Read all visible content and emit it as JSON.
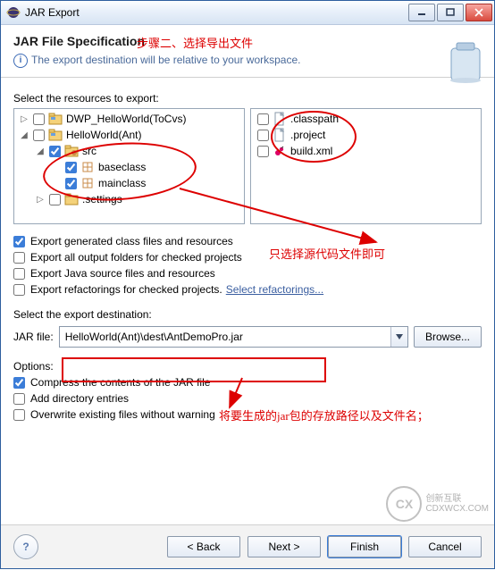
{
  "window": {
    "title": "JAR Export"
  },
  "header": {
    "title": "JAR File Specification",
    "subtitle": "The export destination will be relative to your workspace.",
    "annotation_step": "步骤二、选择导出文件"
  },
  "labels": {
    "select_resources": "Select the resources to export:",
    "select_destination": "Select the export destination:",
    "jar_file": "JAR file:",
    "options": "Options:",
    "browse": "Browse...",
    "back": "< Back",
    "next": "Next >",
    "finish": "Finish",
    "cancel": "Cancel",
    "select_refactorings": "Select refactorings..."
  },
  "left_tree": [
    {
      "indent": 0,
      "twisty": "▷",
      "checked": false,
      "icon": "project",
      "label": "DWP_HelloWorld(ToCvs)"
    },
    {
      "indent": 0,
      "twisty": "◢",
      "checked": false,
      "icon": "project",
      "label": "HelloWorld(Ant)"
    },
    {
      "indent": 1,
      "twisty": "◢",
      "checked": true,
      "icon": "srcfolder",
      "label": "src"
    },
    {
      "indent": 2,
      "twisty": "",
      "checked": true,
      "icon": "package",
      "label": "baseclass"
    },
    {
      "indent": 2,
      "twisty": "",
      "checked": true,
      "icon": "package",
      "label": "mainclass"
    },
    {
      "indent": 1,
      "twisty": "▷",
      "checked": false,
      "icon": "folder",
      "label": ".settings"
    }
  ],
  "right_tree": [
    {
      "checked": false,
      "icon": "file",
      "label": ".classpath"
    },
    {
      "checked": false,
      "icon": "file",
      "label": ".project"
    },
    {
      "checked": false,
      "icon": "ant",
      "label": "build.xml"
    }
  ],
  "export_opts": {
    "generated": "Export generated class files and resources",
    "output_folders": "Export all output folders for checked projects",
    "java_source": "Export Java source files and resources",
    "refactorings": "Export refactorings for checked projects."
  },
  "export_checked": {
    "generated": true,
    "output_folders": false,
    "java_source": false,
    "refactorings": false
  },
  "dest": {
    "value": "HelloWorld(Ant)\\dest\\AntDemoPro.jar"
  },
  "options_group": {
    "compress": "Compress the contents of the JAR file",
    "add_dir": "Add directory entries",
    "overwrite": "Overwrite existing files without warning"
  },
  "options_checked": {
    "compress": true,
    "add_dir": false,
    "overwrite": false
  },
  "annotations": {
    "only_source": "只选择源代码文件即可",
    "dest_note": "将要生成的jar包的存放路径以及文件名；"
  },
  "watermark": {
    "brand": "创新互联",
    "sub": "CDXWCX.COM"
  }
}
